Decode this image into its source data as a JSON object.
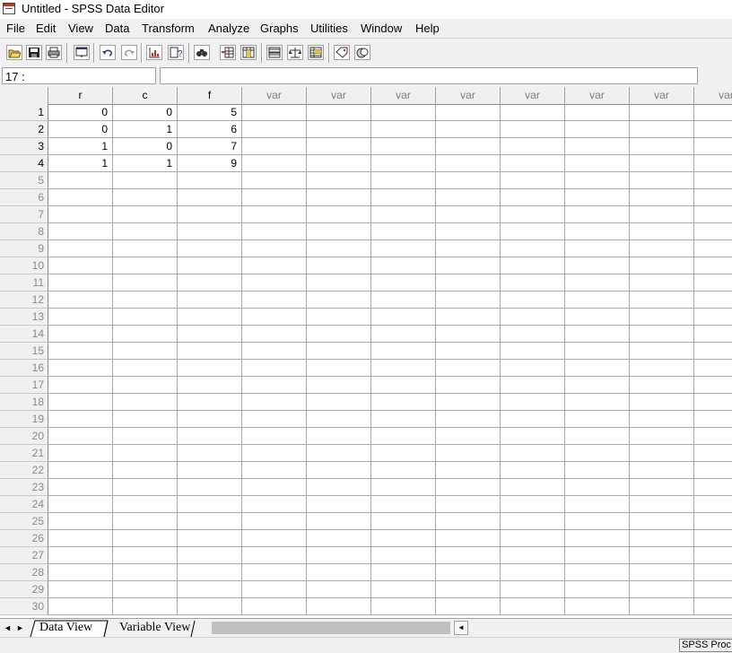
{
  "window": {
    "title": "Untitled - SPSS Data Editor"
  },
  "menu": [
    "File",
    "Edit",
    "View",
    "Data",
    "Transform",
    "Analyze",
    "Graphs",
    "Utilities",
    "Window",
    "Help"
  ],
  "toolbar": {
    "icons": [
      "open-icon",
      "save-icon",
      "print-icon",
      "dialog-recall-icon",
      "undo-icon",
      "redo-icon",
      "goto-chart-icon",
      "goto-case-icon",
      "variables-icon",
      "find-icon",
      "insert-case-icon",
      "insert-variable-icon",
      "split-file-icon",
      "weight-cases-icon",
      "select-cases-icon",
      "value-labels-icon",
      "use-sets-icon"
    ]
  },
  "cell_editor": {
    "ref": "17 :",
    "value": ""
  },
  "grid": {
    "columns": [
      "r",
      "c",
      "f",
      "var",
      "var",
      "var",
      "var",
      "var",
      "var",
      "var",
      "var"
    ],
    "data": [
      [
        "0",
        "0",
        "5"
      ],
      [
        "0",
        "1",
        "6"
      ],
      [
        "1",
        "0",
        "7"
      ],
      [
        "1",
        "1",
        "9"
      ]
    ],
    "row_numbers": [
      "1",
      "2",
      "3",
      "4",
      "5",
      "6",
      "7",
      "8",
      "9",
      "10",
      "11",
      "12",
      "13",
      "14",
      "15",
      "16",
      "17",
      "18",
      "19",
      "20",
      "21",
      "22",
      "23",
      "24",
      "25",
      "26",
      "27",
      "28",
      "29",
      "30"
    ]
  },
  "tabs": {
    "data_view": "Data View",
    "variable_view": "Variable View"
  },
  "status": {
    "text": "SPSS Proc"
  }
}
